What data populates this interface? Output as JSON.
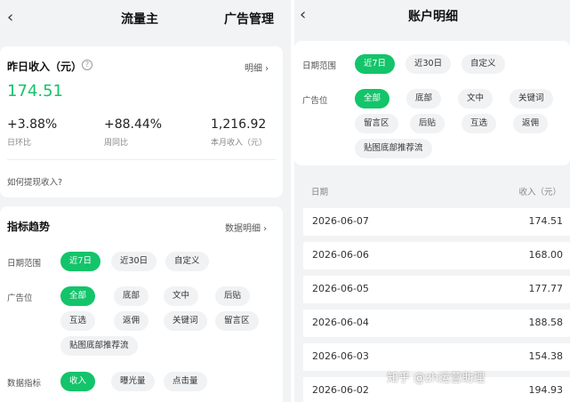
{
  "left": {
    "back_glyph": "‹",
    "tab_title": "流量主",
    "tab_ads": "广告管理",
    "income": {
      "title": "昨日收入（元）",
      "help_glyph": "?",
      "detail_link": "明细 ›",
      "amount": "174.51",
      "stats": [
        {
          "value": "+3.88%",
          "label": "日环比"
        },
        {
          "value": "+88.44%",
          "label": "周同比"
        },
        {
          "value": "1,216.92",
          "label": "本月收入（元）"
        }
      ],
      "withdraw_link": "如何提现收入?"
    },
    "trend": {
      "title": "指标趋势",
      "data_link": "数据明细 ›",
      "date_label": "日期范围",
      "date_options": [
        "近7日",
        "近30日",
        "自定义"
      ],
      "slot_label": "广告位",
      "slot_options": [
        "全部",
        "底部",
        "文中",
        "后贴",
        "互选",
        "返佣",
        "关键词",
        "留言区",
        "贴图底部推荐流"
      ],
      "metric_label": "数据指标",
      "metric_options": [
        "收入",
        "曝光量",
        "点击量"
      ]
    }
  },
  "right": {
    "back_glyph": "‹",
    "title": "账户明细",
    "date_label": "日期范围",
    "date_options": [
      "近7日",
      "近30日",
      "自定义"
    ],
    "slot_label": "广告位",
    "slot_options": [
      "全部",
      "底部",
      "文中",
      "关键词",
      "留言区",
      "后贴",
      "互选",
      "返佣",
      "贴图底部推荐流"
    ],
    "table": {
      "col_date": "日期",
      "col_income": "收入（元）",
      "rows": [
        {
          "date": "2026-06-07",
          "income": "174.51"
        },
        {
          "date": "2026-06-06",
          "income": "168.00"
        },
        {
          "date": "2026-06-05",
          "income": "177.77"
        },
        {
          "date": "2026-06-04",
          "income": "188.58"
        },
        {
          "date": "2026-06-03",
          "income": "154.38"
        },
        {
          "date": "2026-06-02",
          "income": "194.93"
        }
      ]
    }
  },
  "watermark": "知乎 @zh运营助理",
  "colors": {
    "accent": "#13c46a",
    "background": "#f2f3f5",
    "card": "#ffffff"
  }
}
